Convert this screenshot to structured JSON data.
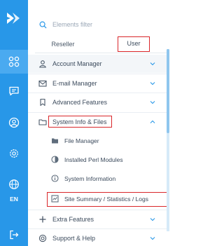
{
  "rail": {
    "language": "EN"
  },
  "search": {
    "placeholder": "Elements filter"
  },
  "tabs": [
    {
      "label": "Reseller",
      "active": false
    },
    {
      "label": "User",
      "active": true
    }
  ],
  "menu": {
    "account_manager": "Account Manager",
    "email_manager": "E-mail Manager",
    "advanced_features": "Advanced Features",
    "system_info": "System Info & Files",
    "system_info_items": [
      "File Manager",
      "Installed Perl Modules",
      "System Information",
      "Site Summary / Statistics / Logs"
    ],
    "extra_features": "Extra Features",
    "support_help": "Support & Help"
  },
  "colors": {
    "rail": "#2897e8",
    "rail_active": "#4aaaf0",
    "highlight": "#d9262a",
    "icon_gray": "#7d8a99"
  }
}
